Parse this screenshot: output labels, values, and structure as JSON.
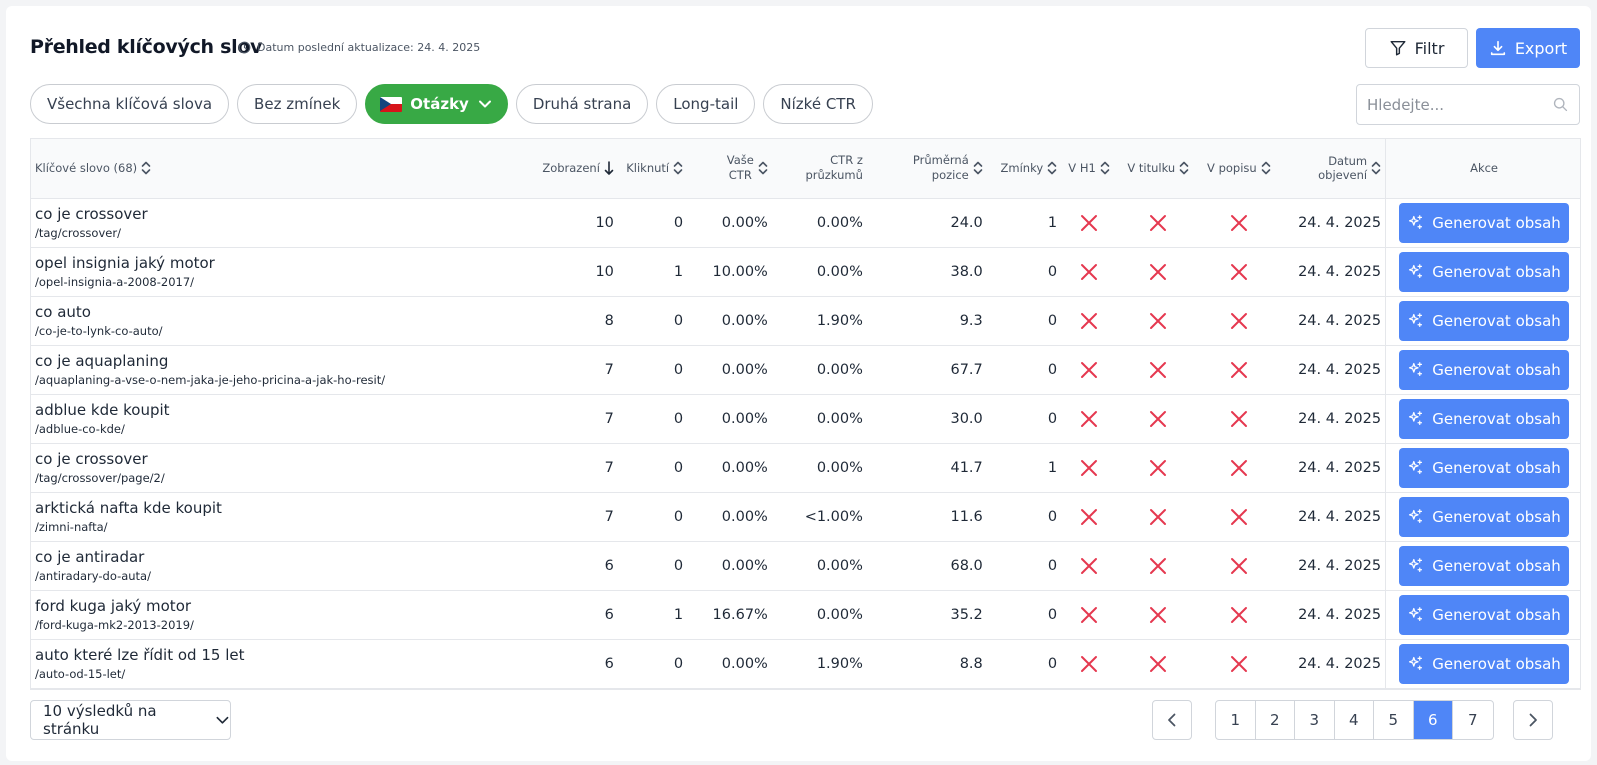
{
  "header": {
    "title": "Přehled klíčových slov",
    "updated_label": "Datum poslední aktualizace: 24. 4. 2025",
    "filter_label": "Filtr",
    "export_label": "Export"
  },
  "chips": [
    {
      "label": "Všechna klíčová slova"
    },
    {
      "label": "Bez zmínek"
    },
    {
      "label": "Otázky",
      "active": true
    },
    {
      "label": "Druhá strana"
    },
    {
      "label": "Long-tail"
    },
    {
      "label": "Nízké CTR"
    }
  ],
  "search": {
    "placeholder": "Hledejte..."
  },
  "table": {
    "columns": {
      "keyword": "Klíčové slovo (68)",
      "impressions": "Zobrazení",
      "clicks": "Kliknutí",
      "ctr_1": "Vaše",
      "ctr_2": "CTR",
      "survey_ctr_1": "CTR z",
      "survey_ctr_2": "průzkumů",
      "position_1": "Průměrná",
      "position_2": "pozice",
      "mentions": "Zmínky",
      "h1": "V H1",
      "in_title": "V titulku",
      "in_desc": "V popisu",
      "discovered": "Datum objevení",
      "actions": "Akce"
    },
    "action_label": "Generovat obsah",
    "rows": [
      {
        "keyword": "co je crossover",
        "url": "/tag/crossover/",
        "impressions": "10",
        "clicks": "0",
        "ctr": "0.00%",
        "survey_ctr": "0.00%",
        "position": "24.0",
        "mentions": "1",
        "date": "24. 4. 2025"
      },
      {
        "keyword": "opel insignia jaký motor",
        "url": "/opel-insignia-a-2008-2017/",
        "impressions": "10",
        "clicks": "1",
        "ctr": "10.00%",
        "survey_ctr": "0.00%",
        "position": "38.0",
        "mentions": "0",
        "date": "24. 4. 2025"
      },
      {
        "keyword": "co auto",
        "url": "/co-je-to-lynk-co-auto/",
        "impressions": "8",
        "clicks": "0",
        "ctr": "0.00%",
        "survey_ctr": "1.90%",
        "position": "9.3",
        "mentions": "0",
        "date": "24. 4. 2025"
      },
      {
        "keyword": "co je aquaplaning",
        "url": "/aquaplaning-a-vse-o-nem-jaka-je-jeho-pricina-a-jak-ho-resit/",
        "impressions": "7",
        "clicks": "0",
        "ctr": "0.00%",
        "survey_ctr": "0.00%",
        "position": "67.7",
        "mentions": "0",
        "date": "24. 4. 2025"
      },
      {
        "keyword": "adblue kde koupit",
        "url": "/adblue-co-kde/",
        "impressions": "7",
        "clicks": "0",
        "ctr": "0.00%",
        "survey_ctr": "0.00%",
        "position": "30.0",
        "mentions": "0",
        "date": "24. 4. 2025"
      },
      {
        "keyword": "co je crossover",
        "url": "/tag/crossover/page/2/",
        "impressions": "7",
        "clicks": "0",
        "ctr": "0.00%",
        "survey_ctr": "0.00%",
        "position": "41.7",
        "mentions": "1",
        "date": "24. 4. 2025"
      },
      {
        "keyword": "arktická nafta kde koupit",
        "url": "/zimni-nafta/",
        "impressions": "7",
        "clicks": "0",
        "ctr": "0.00%",
        "survey_ctr": "<1.00%",
        "position": "11.6",
        "mentions": "0",
        "date": "24. 4. 2025"
      },
      {
        "keyword": "co je antiradar",
        "url": "/antiradary-do-auta/",
        "impressions": "6",
        "clicks": "0",
        "ctr": "0.00%",
        "survey_ctr": "0.00%",
        "position": "68.0",
        "mentions": "0",
        "date": "24. 4. 2025"
      },
      {
        "keyword": "ford kuga jaký motor",
        "url": "/ford-kuga-mk2-2013-2019/",
        "impressions": "6",
        "clicks": "1",
        "ctr": "16.67%",
        "survey_ctr": "0.00%",
        "position": "35.2",
        "mentions": "0",
        "date": "24. 4. 2025"
      },
      {
        "keyword": "auto které lze řídit od 15 let",
        "url": "/auto-od-15-let/",
        "impressions": "6",
        "clicks": "0",
        "ctr": "0.00%",
        "survey_ctr": "1.90%",
        "position": "8.8",
        "mentions": "0",
        "date": "24. 4. 2025"
      }
    ]
  },
  "pagination": {
    "per_page_label": "10 výsledků na stránku",
    "pages": [
      "1",
      "2",
      "3",
      "4",
      "5",
      "6",
      "7"
    ],
    "current": "6"
  },
  "colors": {
    "primary": "#4f86f7",
    "chip_active": "#38a945",
    "cross": "#e5384f"
  },
  "icons": {
    "updated": "clock-icon",
    "filter": "funnel-icon",
    "export": "download-icon",
    "search": "search-icon",
    "generate": "sparkles-icon",
    "flag": "czech-flag-icon",
    "false_value": "cross-icon"
  }
}
